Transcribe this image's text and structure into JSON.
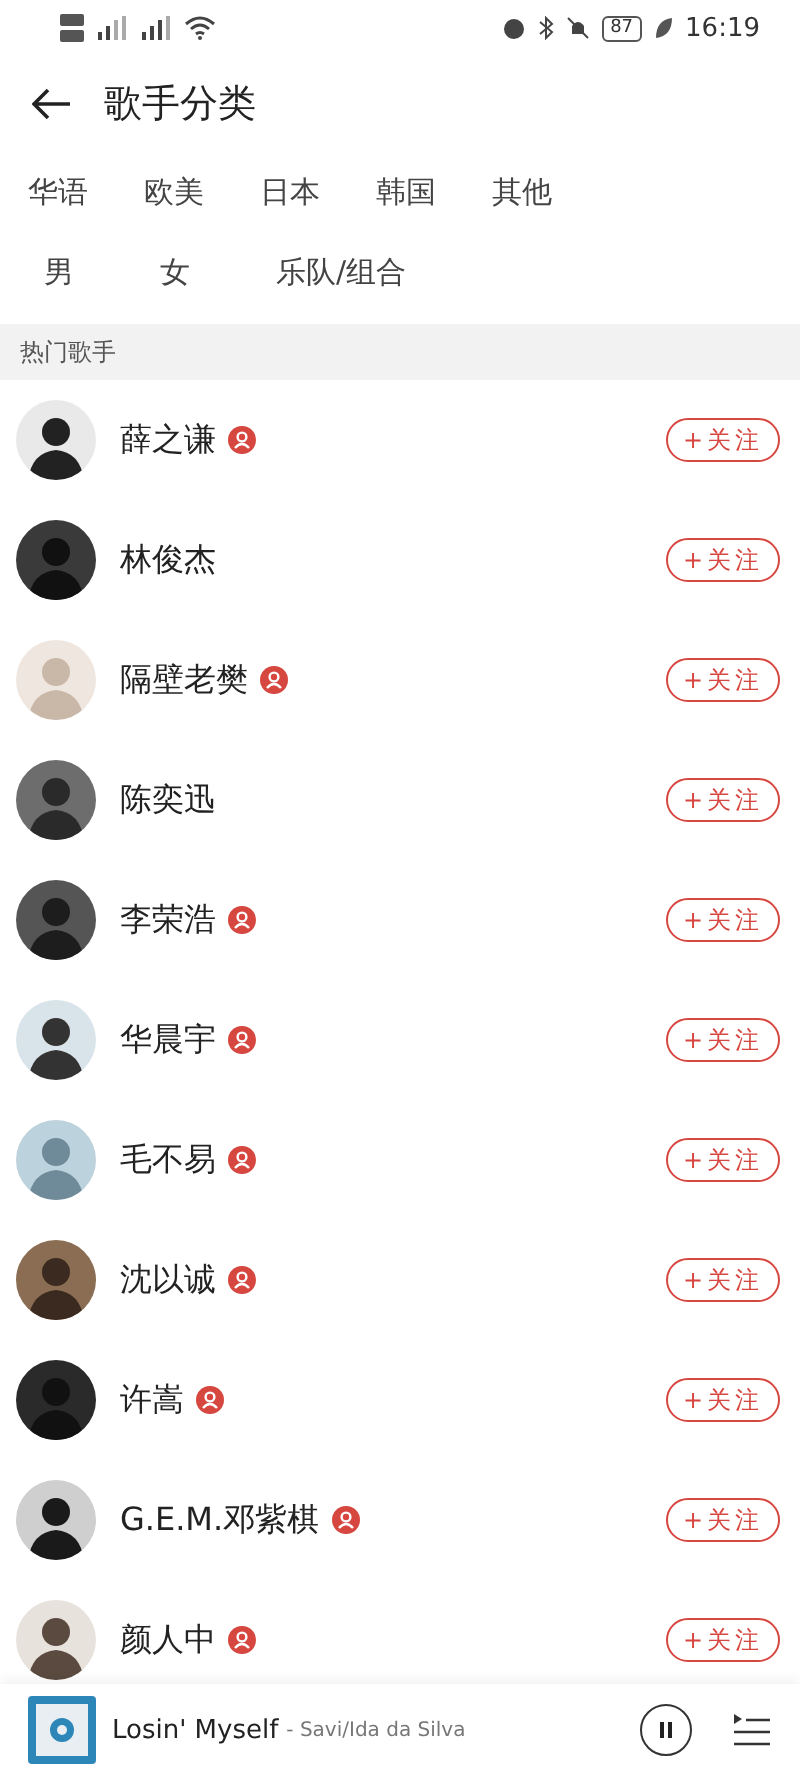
{
  "status_bar": {
    "battery": "87",
    "time": "16:19"
  },
  "header": {
    "title": "歌手分类"
  },
  "filters": [
    [
      "华语",
      "欧美",
      "日本",
      "韩国",
      "其他"
    ],
    [
      "男",
      "女",
      "乐队/组合"
    ]
  ],
  "section": {
    "title": "热门歌手"
  },
  "artists": [
    {
      "name": "薛之谦",
      "verified": true,
      "follow": "+关注"
    },
    {
      "name": "林俊杰",
      "verified": false,
      "follow": "+关注"
    },
    {
      "name": "隔壁老樊",
      "verified": true,
      "follow": "+关注"
    },
    {
      "name": "陈奕迅",
      "verified": false,
      "follow": "+关注"
    },
    {
      "name": "李荣浩",
      "verified": true,
      "follow": "+关注"
    },
    {
      "name": "华晨宇",
      "verified": true,
      "follow": "+关注"
    },
    {
      "name": "毛不易",
      "verified": true,
      "follow": "+关注"
    },
    {
      "name": "沈以诚",
      "verified": true,
      "follow": "+关注"
    },
    {
      "name": "许嵩",
      "verified": true,
      "follow": "+关注"
    },
    {
      "name": "G.E.M.邓紫棋",
      "verified": true,
      "follow": "+关注"
    },
    {
      "name": "颜人中",
      "verified": true,
      "follow": "+关注"
    }
  ],
  "player": {
    "title": "Losin' Myself",
    "artist": "- Savi/Ida da Silva",
    "playing": true
  }
}
